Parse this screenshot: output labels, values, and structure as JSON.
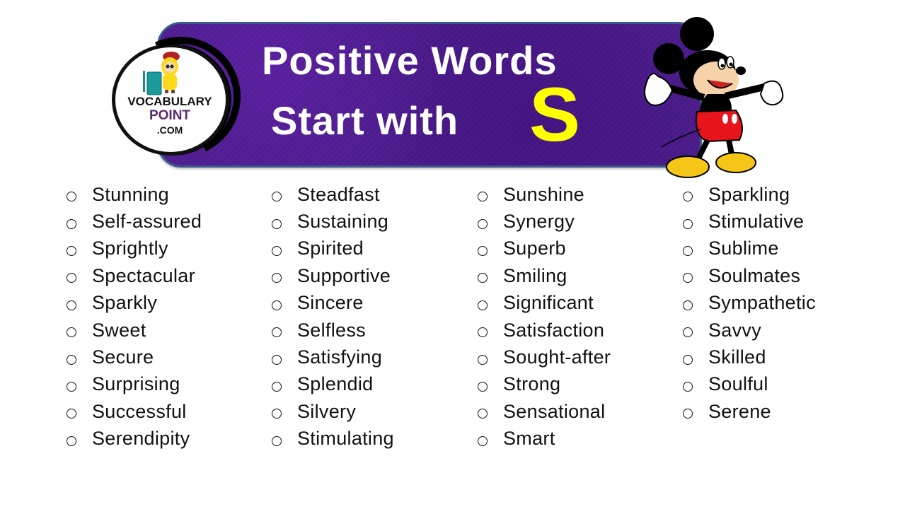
{
  "banner": {
    "title_line_1": "Positive Words",
    "title_line_2": "Start with",
    "title_letter": "S",
    "background_color": "#4a1a8c",
    "letter_color": "#ffff00"
  },
  "logo": {
    "line_1": "VOCABULARY",
    "line_2": "POINT",
    "line_3": ".COM"
  },
  "icons": {
    "logo_mascot": "yellow-raincoat-kid-icon",
    "logo_book": "teal-notebook-icon",
    "character": "mickey-mouse-illustration",
    "bullet": "hollow-circle-bullet"
  },
  "columns": [
    {
      "words": [
        "Stunning",
        "Self-assured",
        "Sprightly",
        "Spectacular",
        "Sparkly",
        "Sweet",
        "Secure",
        "Surprising",
        "Successful",
        "Serendipity"
      ]
    },
    {
      "words": [
        "Steadfast",
        "Sustaining",
        "Spirited",
        "Supportive",
        "Sincere",
        "Selfless",
        "Satisfying",
        "Splendid",
        "Silvery",
        "Stimulating"
      ]
    },
    {
      "words": [
        "Sunshine",
        "Synergy",
        "Superb",
        "Smiling",
        "Significant",
        "Satisfaction",
        "Sought-after",
        "Strong",
        "Sensational",
        "Smart"
      ]
    },
    {
      "words": [
        "Sparkling",
        "Stimulative",
        "Sublime",
        "Soulmates",
        "Sympathetic",
        "Savvy",
        "Skilled",
        "Soulful",
        "Serene"
      ]
    }
  ]
}
